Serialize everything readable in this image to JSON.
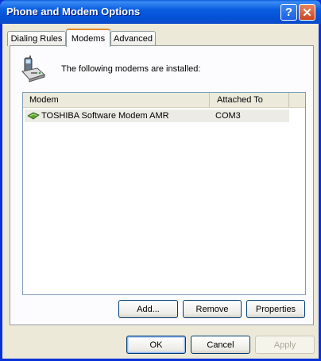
{
  "window": {
    "title": "Phone and Modem Options",
    "help_glyph": "?",
    "close_glyph": "✕"
  },
  "tabs": [
    {
      "label": "Dialing Rules",
      "active": false
    },
    {
      "label": "Modems",
      "active": true
    },
    {
      "label": "Advanced",
      "active": false
    }
  ],
  "modems_tab": {
    "info_text": "The following modems are  installed:",
    "columns": [
      "Modem",
      "Attached To"
    ],
    "rows": [
      {
        "modem": "TOSHIBA Software Modem AMR",
        "attached_to": "COM3",
        "icon": "modem-icon"
      }
    ],
    "buttons": {
      "add": "Add...",
      "remove": "Remove",
      "properties": "Properties"
    }
  },
  "dialog_buttons": {
    "ok": "OK",
    "cancel": "Cancel",
    "apply": "Apply"
  },
  "colors": {
    "title_bar": "#0a5ee0",
    "window_bg": "#ece9d8",
    "active_tab_accent": "#e68b2c",
    "close_button": "#c9461f"
  }
}
